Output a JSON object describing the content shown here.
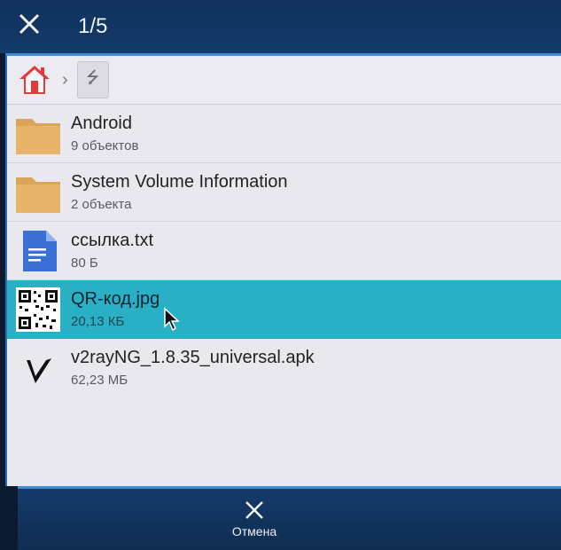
{
  "header": {
    "counter": "1/5",
    "close_icon": "close-icon"
  },
  "breadcrumb": {
    "home_icon": "home-icon",
    "separator": "›",
    "usb_icon": "usb-drive-icon",
    "usb_glyph": "⭍"
  },
  "files": [
    {
      "name": "Android",
      "info": "9 объектов",
      "type": "folder"
    },
    {
      "name": "System Volume Information",
      "info": "2 объекта",
      "type": "folder"
    },
    {
      "name": "ссылка.txt",
      "info": "80 Б",
      "type": "document"
    },
    {
      "name": "QR-код.jpg",
      "info": "20,13 КБ",
      "type": "image",
      "selected": true
    },
    {
      "name": "v2rayNG_1.8.35_universal.apk",
      "info": "62,23 МБ",
      "type": "apk"
    }
  ],
  "footer": {
    "cancel_label": "Отмена",
    "cancel_icon": "close-icon"
  },
  "colors": {
    "selected": "#2ab0c4",
    "bar": "#133a6a",
    "accent": "#3d8ed6"
  }
}
